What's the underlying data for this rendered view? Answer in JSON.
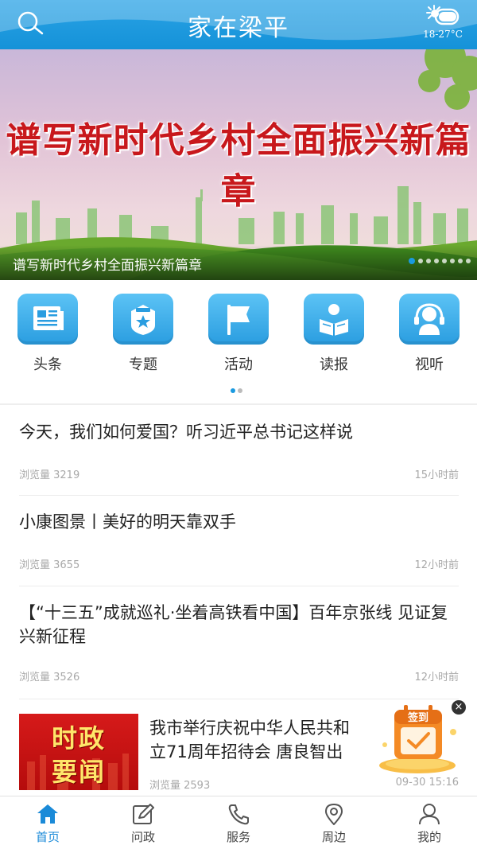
{
  "header": {
    "title": "家在梁平",
    "temperature": "18-27°C",
    "search_icon": "search-icon",
    "weather_icon": "partly-sunny-icon"
  },
  "banner": {
    "headline": "谱写新时代乡村全面振兴新篇章",
    "caption": "谱写新时代乡村全面振兴新篇章",
    "slide_count": 8,
    "active_slide": 1
  },
  "categories": {
    "items": [
      {
        "label": "头条",
        "icon": "newspaper-icon"
      },
      {
        "label": "专题",
        "icon": "star-badge-icon"
      },
      {
        "label": "活动",
        "icon": "flag-icon"
      },
      {
        "label": "读报",
        "icon": "reader-icon"
      },
      {
        "label": "视听",
        "icon": "headset-icon"
      }
    ],
    "page_count": 2,
    "active_page": 1
  },
  "news": [
    {
      "title": "今天，我们如何爱国？听习近平总书记这样说",
      "views": "浏览量 3219",
      "time": "15小时前"
    },
    {
      "title": "小康图景丨美好的明天靠双手",
      "views": "浏览量 3655",
      "time": "12小时前"
    },
    {
      "title": "【“十三五”成就巡礼·坐着高铁看中国】百年京张线 见证复兴新征程",
      "views": "浏览量 3526",
      "time": "12小时前"
    },
    {
      "title": "我市举行庆祝中华人民共和国成立71周年招待会 唐良智出席",
      "title_line1": "我市举行庆祝中华人民共和",
      "title_line2": "立71周年招待会 唐良智出",
      "views": "浏览量 2593",
      "time": "09-30 15:16",
      "thumb_line1": "时政",
      "thumb_line2": "要闻"
    }
  ],
  "signin_badge": {
    "label": "签到",
    "close": "×"
  },
  "tabbar": {
    "items": [
      {
        "label": "首页",
        "icon": "home-icon",
        "active": true
      },
      {
        "label": "问政",
        "icon": "edit-icon",
        "active": false
      },
      {
        "label": "服务",
        "icon": "phone-icon",
        "active": false
      },
      {
        "label": "周边",
        "icon": "location-pin-icon",
        "active": false
      },
      {
        "label": "我的",
        "icon": "user-icon",
        "active": false
      }
    ]
  },
  "colors": {
    "primary": "#1a9ae0",
    "headline_red": "#c8181c",
    "muted": "#a8a8a8"
  }
}
